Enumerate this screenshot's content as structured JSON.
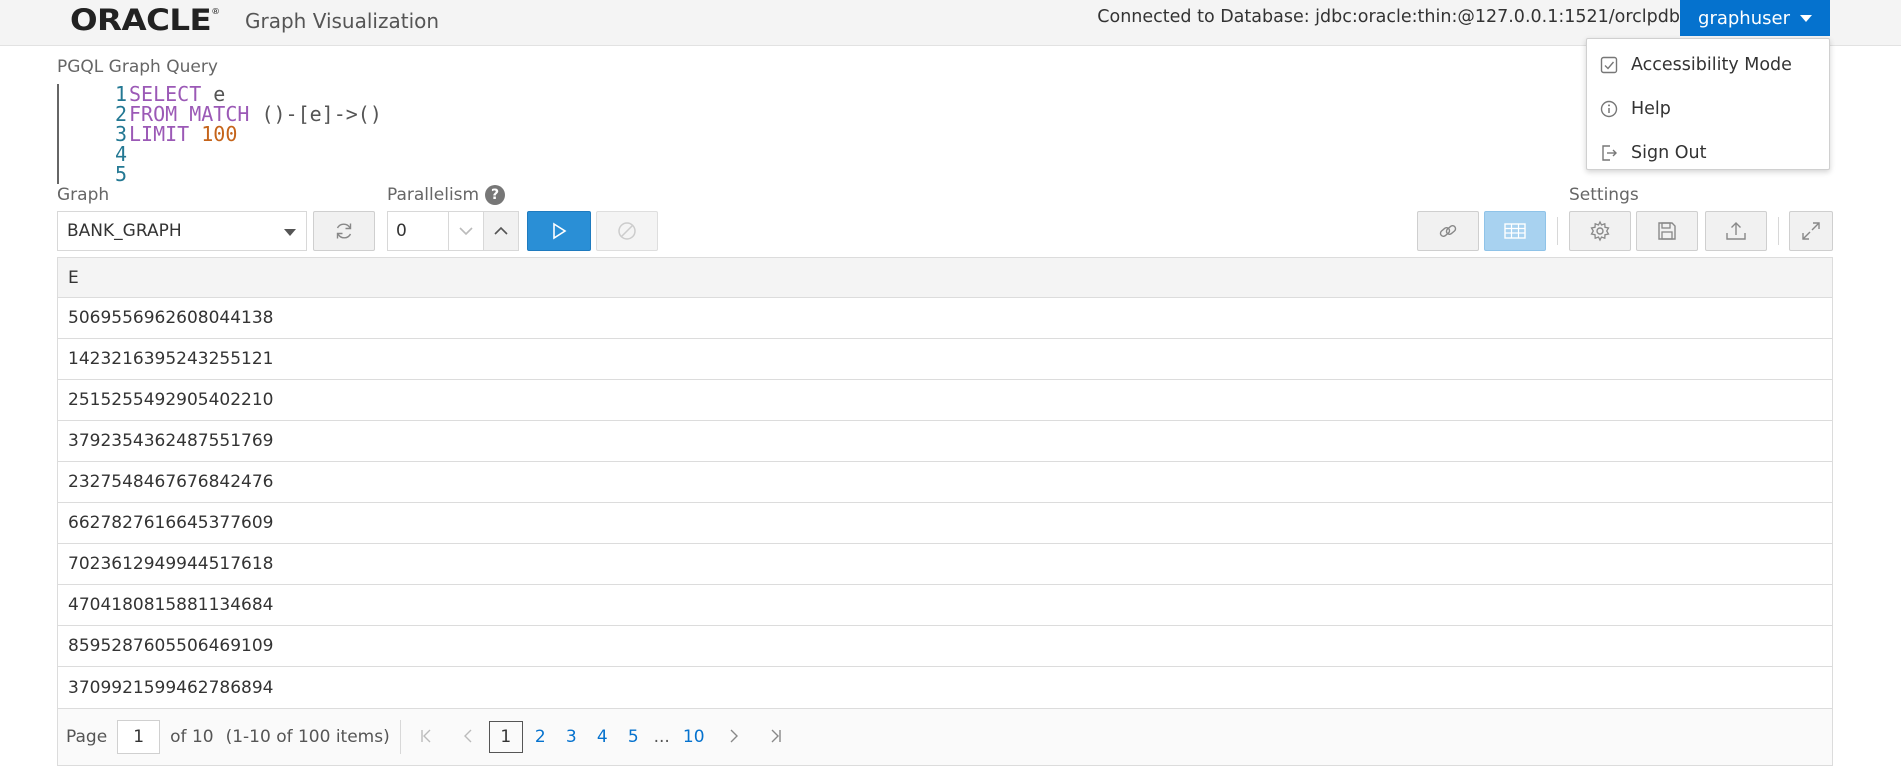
{
  "header": {
    "logo": "ORACLE",
    "logo_mark": "®",
    "app_title": "Graph Visualization",
    "connection": "Connected to Database: jdbc:oracle:thin:@127.0.0.1:1521/orclpdb",
    "user": "graphuser"
  },
  "user_menu": {
    "items": [
      {
        "label": "Accessibility Mode",
        "icon": "checkbox-icon"
      },
      {
        "label": "Help",
        "icon": "info-icon"
      },
      {
        "label": "Sign Out",
        "icon": "sign-out-icon"
      }
    ]
  },
  "query": {
    "label": "PGQL Graph Query",
    "lines": [
      {
        "n": "1",
        "kw": "SELECT",
        "rest": " e"
      },
      {
        "n": "2",
        "kw": "FROM MATCH",
        "rest": " ()-[e]->()"
      },
      {
        "n": "3",
        "kw": "LIMIT",
        "rest": " 100"
      },
      {
        "n": "4",
        "kw": "",
        "rest": ""
      },
      {
        "n": "5",
        "kw": "",
        "rest": ""
      }
    ]
  },
  "controls": {
    "graph_label": "Graph",
    "graph_value": "BANK_GRAPH",
    "parallelism_label": "Parallelism",
    "parallelism_help": "?",
    "parallelism_value": "0",
    "settings_label": "Settings"
  },
  "table": {
    "column": "E",
    "rows": [
      "5069556962608044138",
      "1423216395243255121",
      "2515255492905402210",
      "3792354362487551769",
      "2327548467676842476",
      "6627827616645377609",
      "7023612949944517618",
      "4704180815881134684",
      "8595287605506469109",
      "3709921599462786894"
    ]
  },
  "pagination": {
    "page_label": "Page",
    "page_value": "1",
    "of_label": "of 10",
    "items_label": "(1-10 of 100 items)",
    "first": "K",
    "prev": "‹",
    "pages": [
      "1",
      "2",
      "3",
      "4",
      "5"
    ],
    "ellipsis": "...",
    "last_page": "10",
    "next": "›",
    "last": "›|"
  },
  "colors": {
    "accent": "#0572ce",
    "run_button": "#2a8fd6",
    "table_toggle_active": "#a8d2f0"
  }
}
